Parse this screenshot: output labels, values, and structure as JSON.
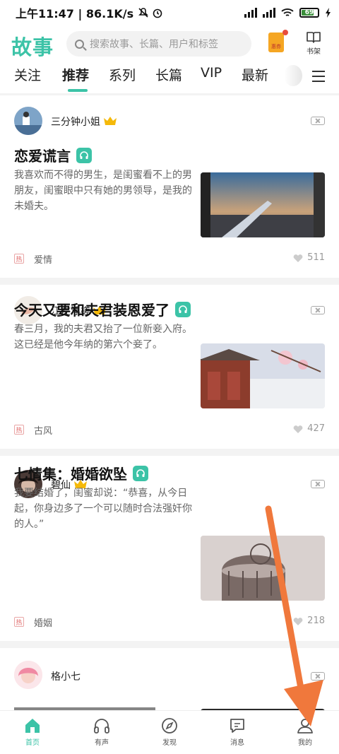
{
  "status_bar": {
    "time_speed": "上午11:47 | 86.1K/s",
    "battery": "69"
  },
  "header": {
    "logo": "故事",
    "search_placeholder": "搜索故事、长篇、用户和标签",
    "red_packet_label": "惠券",
    "bookshelf_label": "书架"
  },
  "tabs": [
    {
      "label": "关注"
    },
    {
      "label": "推荐"
    },
    {
      "label": "系列"
    },
    {
      "label": "长篇"
    },
    {
      "label": "VIP"
    },
    {
      "label": "最新"
    }
  ],
  "active_tab": "推荐",
  "feed": [
    {
      "author": "三分钟小姐",
      "title": "恋爱谎言",
      "excerpt": "我喜欢而不得的男生，是闺蜜看不上的男朋友，闺蜜眼中只有她的男领导，是我的未婚夫。",
      "tag_icon": "热",
      "tag": "爱情",
      "likes": "511"
    },
    {
      "author": "江左浮槎",
      "title": "今天又要和夫君装恩爱了",
      "excerpt": "春三月，我的夫君又抬了一位新妾入府。这已经是他今年纳的第六个妾了。",
      "tag_icon": "热",
      "tag": "古风",
      "likes": "427"
    },
    {
      "author": "碧仙",
      "title": "七情集：婚婚欲坠",
      "excerpt": "我要结婚了，闺蜜却说：“恭喜，从今日起，你身边多了一个可以随时合法强奸你的人。”",
      "tag_icon": "热",
      "tag": "婚姻",
      "likes": "218"
    },
    {
      "author": "格小七",
      "title": "",
      "excerpt": ""
    }
  ],
  "bottom_nav": [
    {
      "label": "首页",
      "icon": "home-icon"
    },
    {
      "label": "有声",
      "icon": "headphones-icon"
    },
    {
      "label": "发现",
      "icon": "compass-icon"
    },
    {
      "label": "消息",
      "icon": "message-icon"
    },
    {
      "label": "我的",
      "icon": "profile-icon"
    }
  ],
  "colors": {
    "accent": "#3cc3a7",
    "annotation_arrow": "#f0783c"
  }
}
